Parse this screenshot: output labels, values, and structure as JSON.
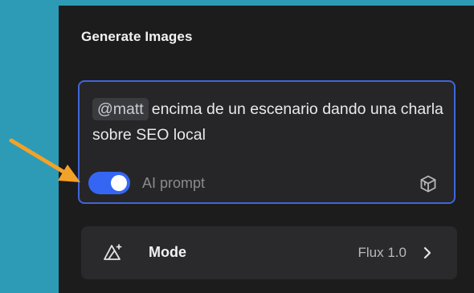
{
  "panel": {
    "title": "Generate Images"
  },
  "prompt": {
    "mention": "@matt",
    "text": "encima de un escenario dando una charla sobre SEO local",
    "ai_prompt_label": "AI prompt",
    "ai_prompt_enabled": true
  },
  "mode": {
    "label": "Mode",
    "value": "Flux 1.0"
  },
  "colors": {
    "accent": "#3566f3",
    "focus_border": "#3f66d8",
    "annotation_arrow": "#f3a229",
    "backdrop": "#2d9bb5"
  },
  "icons": {
    "toggle": "toggle-switch",
    "enhance": "cube-icon",
    "mode": "triangle-sparkle-icon",
    "chevron": "chevron-right-icon",
    "annotation": "arrow-icon"
  }
}
